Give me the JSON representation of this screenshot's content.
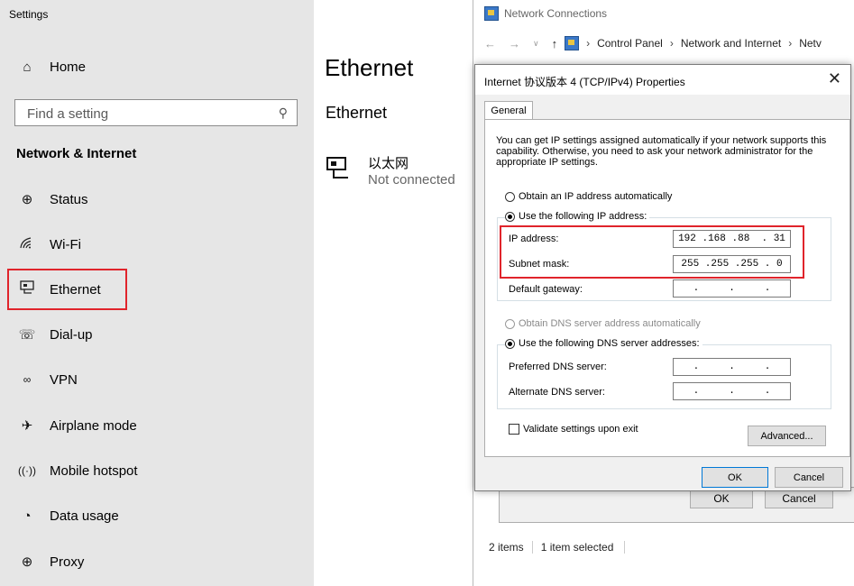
{
  "settings": {
    "app_title": "Settings",
    "home_label": "Home",
    "search_placeholder": "Find a setting",
    "section_title": "Network & Internet",
    "nav": [
      {
        "label": "Status",
        "icon": "globe-icon"
      },
      {
        "label": "Wi-Fi",
        "icon": "wifi-icon"
      },
      {
        "label": "Ethernet",
        "icon": "ethernet-icon"
      },
      {
        "label": "Dial-up",
        "icon": "phone-icon"
      },
      {
        "label": "VPN",
        "icon": "vpn-icon"
      },
      {
        "label": "Airplane mode",
        "icon": "airplane-icon"
      },
      {
        "label": "Mobile hotspot",
        "icon": "hotspot-icon"
      },
      {
        "label": "Data usage",
        "icon": "pie-icon"
      },
      {
        "label": "Proxy",
        "icon": "globe-icon"
      }
    ],
    "page_title": "Ethernet",
    "subtitle": "Ethernet",
    "adapter_name": "以太网",
    "adapter_status": "Not connected"
  },
  "network_window": {
    "title": "Network Connections",
    "breadcrumb": [
      "Control Panel",
      "Network and Internet",
      "Netv"
    ],
    "status_items": "2 items",
    "status_selected": "1 item selected",
    "bg_ok": "OK",
    "bg_cancel": "Cancel"
  },
  "dialog": {
    "title": "Internet 协议版本 4 (TCP/IPv4) Properties",
    "tab": "General",
    "description": "You can get IP settings assigned automatically if your network supports this capability. Otherwise, you need to ask your network administrator for the appropriate IP settings.",
    "radio_auto_ip": "Obtain an IP address automatically",
    "radio_manual_ip": "Use the following IP address:",
    "ip_label": "IP address:",
    "ip_value": "192 .168 .88  . 31",
    "mask_label": "Subnet mask:",
    "mask_value": "255 .255 .255 . 0",
    "gateway_label": "Default gateway:",
    "gateway_value": " .     .     . ",
    "radio_auto_dns": "Obtain DNS server address automatically",
    "radio_manual_dns": "Use the following DNS server addresses:",
    "preferred_dns_label": "Preferred DNS server:",
    "preferred_dns_value": " .     .     . ",
    "alternate_dns_label": "Alternate DNS server:",
    "alternate_dns_value": " .     .     . ",
    "validate_label": "Validate settings upon exit",
    "advanced_label": "Advanced...",
    "ok_label": "OK",
    "cancel_label": "Cancel"
  },
  "colors": {
    "highlight": "#e0242b",
    "sidebar_bg": "#e6e6e6",
    "dialog_bg": "#f0f0f0",
    "default_button_border": "#0078d7"
  }
}
